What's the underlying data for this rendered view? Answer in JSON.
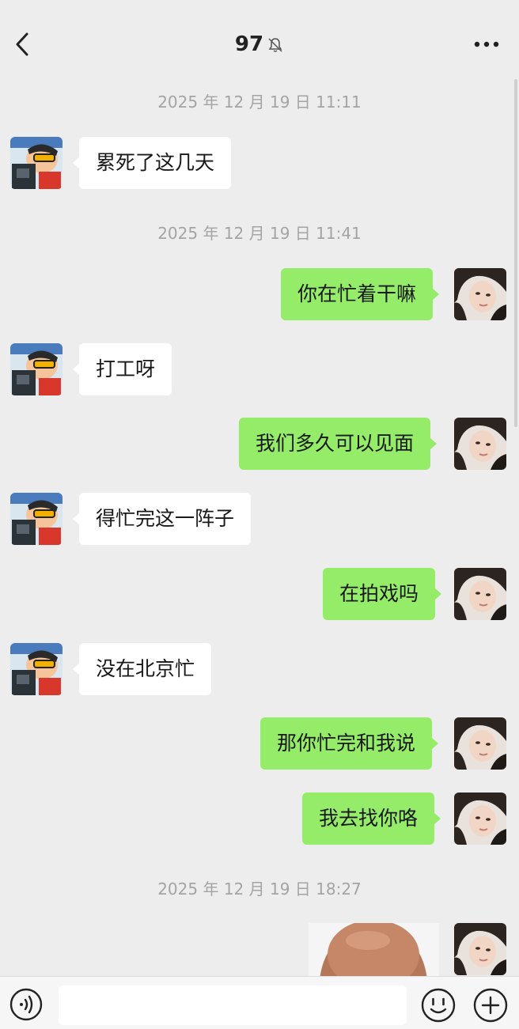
{
  "header": {
    "title": "97",
    "icons": {
      "back": "chevron-left-icon",
      "mute": "bell-off-icon",
      "more": "more-dots-icon"
    }
  },
  "messages": [
    {
      "type": "timestamp",
      "text": "2025 年 12 月 19 日 11:11"
    },
    {
      "type": "msg",
      "side": "left",
      "text": "累死了这几天"
    },
    {
      "type": "timestamp",
      "text": "2025 年 12 月 19 日 11:41"
    },
    {
      "type": "msg",
      "side": "right",
      "text": "你在忙着干嘛"
    },
    {
      "type": "msg",
      "side": "left",
      "text": "打工呀"
    },
    {
      "type": "msg",
      "side": "right",
      "text": "我们多久可以见面"
    },
    {
      "type": "msg",
      "side": "left",
      "text": "得忙完这一阵子"
    },
    {
      "type": "msg",
      "side": "right",
      "text": "在拍戏吗"
    },
    {
      "type": "msg",
      "side": "left",
      "text": "没在北京忙"
    },
    {
      "type": "msg",
      "side": "right",
      "text": "那你忙完和我说"
    },
    {
      "type": "msg",
      "side": "right",
      "text": "我去找你咯"
    },
    {
      "type": "timestamp",
      "text": "2025 年 12 月 19 日 18:27"
    },
    {
      "type": "image",
      "side": "right"
    }
  ],
  "input_bar": {
    "placeholder": "",
    "icons": {
      "voice": "voice-icon",
      "emoji": "emoji-icon",
      "plus": "plus-icon"
    }
  },
  "colors": {
    "background": "#ededed",
    "self_bubble": "#95ec69",
    "other_bubble": "#ffffff",
    "timestamp": "#a4a4a4"
  }
}
